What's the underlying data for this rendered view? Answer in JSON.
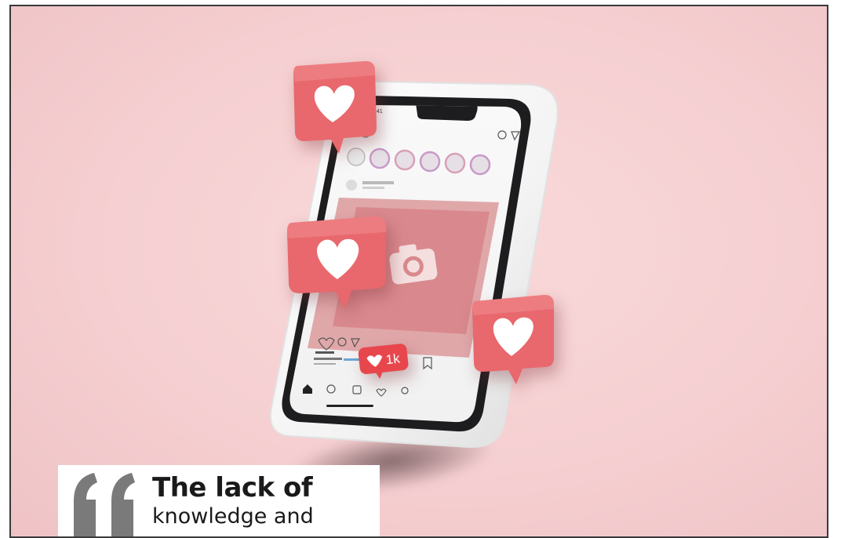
{
  "quote": {
    "line1": "The lack of",
    "line2": "knowledge and"
  },
  "phone": {
    "status_time": "9:41",
    "likes_badge": "1k"
  },
  "colors": {
    "background": "#f5cfd1",
    "bubble": "#e8686d",
    "heart": "#ffffff",
    "phone_body": "#ffffff",
    "phone_bezel": "#1d1d1f",
    "quote_mark": "#7a7a7a"
  },
  "icons": [
    "heart-icon",
    "camera-icon",
    "home-icon",
    "search-icon",
    "add-post-icon",
    "activity-icon",
    "profile-icon",
    "bookmark-icon",
    "share-icon",
    "comment-icon"
  ]
}
